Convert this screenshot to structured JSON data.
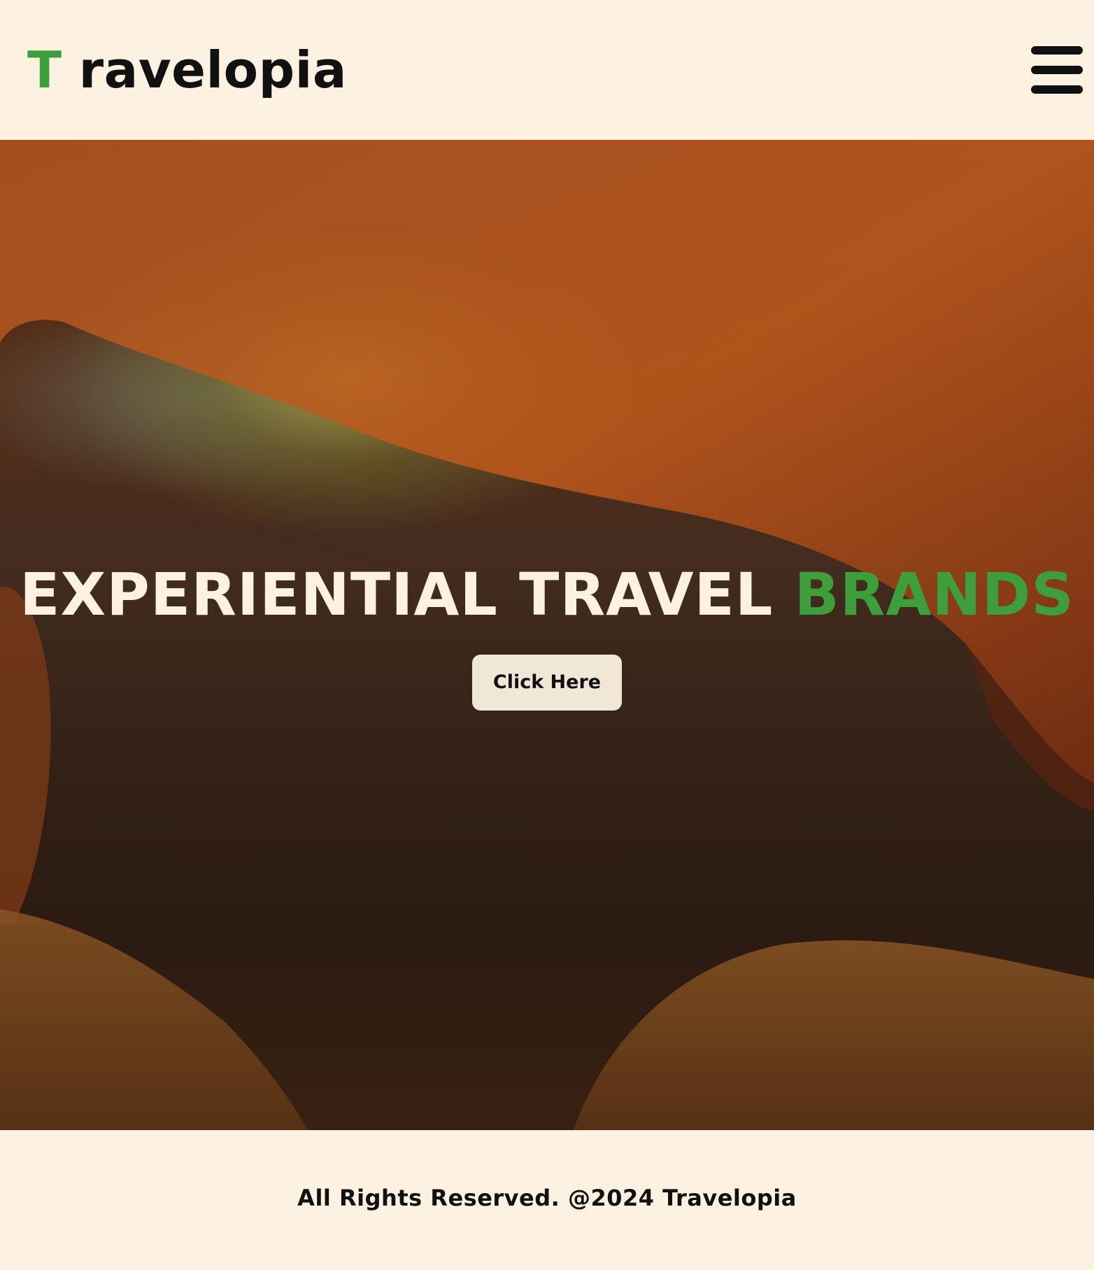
{
  "header": {
    "logo_initial": "T",
    "logo_rest": "ravelopia",
    "menu_icon": "hamburger-menu-icon"
  },
  "hero": {
    "title_main": "EXPERIENTIAL TRAVEL",
    "title_accent": "BRANDS",
    "button_label": "Click Here"
  },
  "footer": {
    "text": "All Rights Reserved. @2024 Travelopia"
  },
  "colors": {
    "background": "#fdf2e1",
    "accent_green": "#3f9e3c",
    "text_dark": "#111111",
    "button_bg": "#f1e7d6"
  }
}
